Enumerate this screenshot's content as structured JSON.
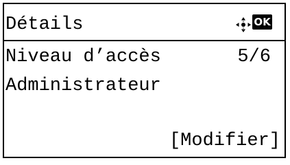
{
  "header": {
    "title": "Détails",
    "nav_icon": "four-way-navigation-icon",
    "ok_label": "OK"
  },
  "details": {
    "field_label": "Niveau d’accès",
    "page_counter": "5/6",
    "value": "Administrateur"
  },
  "softkey": {
    "label": "[Modifier]"
  }
}
